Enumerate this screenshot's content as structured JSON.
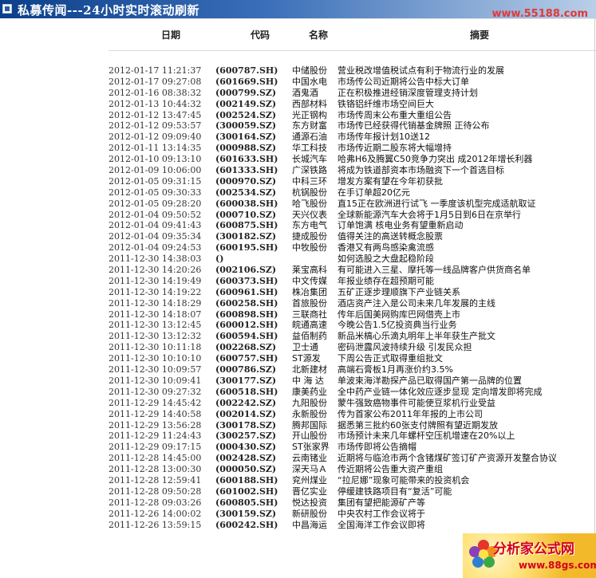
{
  "banner": {
    "title": "私募传闻---24小时实时滚动刷新",
    "site": "www.55188.com"
  },
  "header": {
    "date": "日期",
    "code": "代码",
    "name": "名称",
    "summary": "摘要"
  },
  "ad": {
    "title": "分析家公式网",
    "url": "www.88gs.com"
  },
  "rows": [
    {
      "date": "2012-01-17 11:21:37",
      "code": "(600787.SH)",
      "name": "中储股份",
      "summary": "营业税改增值税试点有利于物流行业的发展"
    },
    {
      "date": "2012-01-17 09:27:08",
      "code": "(601669.SH)",
      "name": "中国水电",
      "summary": "市场传公司近期将公告中标大订单"
    },
    {
      "date": "2012-01-16 08:38:32",
      "code": "(000799.SZ)",
      "name": "酒鬼酒",
      "summary": "正在积极推进经销深度管理支持计划"
    },
    {
      "date": "2012-01-13 10:44:32",
      "code": "(002149.SZ)",
      "name": "西部材料",
      "summary": "铁铬铝纤维市场空间巨大"
    },
    {
      "date": "2012-01-12 13:47:45",
      "code": "(002524.SZ)",
      "name": "光正钢构",
      "summary": "市场传周末公布重大重组公告"
    },
    {
      "date": "2012-01-12 09:53:57",
      "code": "(300059.SZ)",
      "name": "东方财富",
      "summary": "市场传已经获得代销基金牌照 正待公布"
    },
    {
      "date": "2012-01-12 09:09:40",
      "code": "(300164.SZ)",
      "name": "通源石油",
      "summary": "市场传年报计划10送12"
    },
    {
      "date": "2012-01-11 13:14:35",
      "code": "(000988.SZ)",
      "name": "华工科技",
      "summary": "市场传近期二股东将大幅增持"
    },
    {
      "date": "2012-01-10 09:13:10",
      "code": "(601633.SH)",
      "name": "长城汽车",
      "summary": "哈弗H6及腾翼C50竞争力突出 成2012年增长利器"
    },
    {
      "date": "2012-01-09 10:06:00",
      "code": "(601333.SH)",
      "name": "广深铁路",
      "summary": "将成为铁道部资本市场融资下一个首选目标"
    },
    {
      "date": "2012-01-05 09:31:15",
      "code": "(000970.SZ)",
      "name": "中科三环",
      "summary": "增发方案有望在今年初获批"
    },
    {
      "date": "2012-01-05 09:30:33",
      "code": "(002534.SZ)",
      "name": "杭锅股份",
      "summary": "在手订单超20亿元"
    },
    {
      "date": "2012-01-05 09:28:20",
      "code": "(600038.SH)",
      "name": "哈飞股份",
      "summary": "直15正在欧洲进行试飞 一季度该机型完成适航取证"
    },
    {
      "date": "2012-01-04 09:50:52",
      "code": "(000710.SZ)",
      "name": "天兴仪表",
      "summary": "全球新能源汽车大会将于1月5日到6日在京举行"
    },
    {
      "date": "2012-01-04 09:41:43",
      "code": "(600875.SH)",
      "name": "东方电气",
      "summary": "订单饱满 核电业务有望重新启动"
    },
    {
      "date": "2012-01-04 09:35:34",
      "code": "(300182.SZ)",
      "name": "捷成股份",
      "summary": "值得关注的高送转概念股票"
    },
    {
      "date": "2012-01-04 09:24:53",
      "code": "(600195.SH)",
      "name": "中牧股份",
      "summary": "香港又有两鸟感染禽流感"
    },
    {
      "date": "2011-12-30 14:38:03",
      "code": "()",
      "name": "",
      "summary": "如何选股之大盘起稳阶段"
    },
    {
      "date": "2011-12-30 14:20:26",
      "code": "(002106.SZ)",
      "name": "莱宝高科",
      "summary": "有可能进入三星、摩托等一线品牌客户供货商名单"
    },
    {
      "date": "2011-12-30 14:19:49",
      "code": "(600373.SH)",
      "name": "中文传媒",
      "summary": "年报业绩存在超预期可能"
    },
    {
      "date": "2011-12-30 14:19:22",
      "code": "(600961.SH)",
      "name": "株冶集团",
      "summary": "五矿正逐步理顺旗下产业链关系"
    },
    {
      "date": "2011-12-30 14:18:29",
      "code": "(600258.SH)",
      "name": "首旅股份",
      "summary": "酒店资产注入是公司未来几年发展的主线"
    },
    {
      "date": "2011-12-30 14:18:07",
      "code": "(600898.SH)",
      "name": "三联商社",
      "summary": "传年后国美网购库巴网借壳上市"
    },
    {
      "date": "2011-12-30 13:12:45",
      "code": "(600012.SH)",
      "name": "皖通高速",
      "summary": "今晚公告1.5亿投资典当行业务"
    },
    {
      "date": "2011-12-30 13:12:32",
      "code": "(600594.SH)",
      "name": "益佰制药",
      "summary": "新品米槁心乐滴丸明年上半年获生产批文"
    },
    {
      "date": "2011-12-30 10:11:18",
      "code": "(002268.SZ)",
      "name": "卫士通",
      "summary": "密码泄露风波持续升级 引发民众担"
    },
    {
      "date": "2011-12-30 10:10:10",
      "code": "(600757.SH)",
      "name": "ST源发",
      "summary": "下周公告正式取得重组批文"
    },
    {
      "date": "2011-12-30 10:09:57",
      "code": "(000786.SZ)",
      "name": "北新建材",
      "summary": "高端石膏板1月再涨价约3.5%"
    },
    {
      "date": "2011-12-30 10:09:41",
      "code": "(300177.SZ)",
      "name": "中 海 达",
      "summary": "单波束海洋勘探产品已取得国产第一品牌的位置"
    },
    {
      "date": "2011-12-30 09:27:32",
      "code": "(600518.SH)",
      "name": "康美药业",
      "summary": "全中药产业链一体化效应逐步显现 定向增发即将完成"
    },
    {
      "date": "2011-12-29 14:45:42",
      "code": "(002242.SZ)",
      "name": "九阳股份",
      "summary": "蒙牛强致癌物事件可能使豆浆机行业受益"
    },
    {
      "date": "2011-12-29 14:40:58",
      "code": "(002014.SZ)",
      "name": "永新股份",
      "summary": "传为首家公布2011年年报的上市公司"
    },
    {
      "date": "2011-12-29 13:56:28",
      "code": "(300178.SZ)",
      "name": "腾邦国际",
      "summary": "据悉第三批约60张支付牌照有望近期发放"
    },
    {
      "date": "2011-12-29 11:24:43",
      "code": "(300257.SZ)",
      "name": "开山股份",
      "summary": "市场预计未来几年螺杆空压机增速在20%以上"
    },
    {
      "date": "2011-12-29 09:17:15",
      "code": "(000430.SZ)",
      "name": "ST张家界",
      "summary": "市场传即将公告摘帽"
    },
    {
      "date": "2011-12-28 14:45:00",
      "code": "(002428.SZ)",
      "name": "云南锗业",
      "summary": "近期将与临沧市两个含锗煤矿签订矿产资源开发整合协议"
    },
    {
      "date": "2011-12-28 13:00:30",
      "code": "(000050.SZ)",
      "name": "深天马Ａ",
      "summary": "传近期将公告重大资产重组"
    },
    {
      "date": "2011-12-28 12:59:41",
      "code": "(600188.SH)",
      "name": "兖州煤业",
      "summary": "“拉尼娜”现象可能带来的投资机会"
    },
    {
      "date": "2011-12-28 09:50:28",
      "code": "(601002.SH)",
      "name": "晋亿实业",
      "summary": "停缓建铁路项目有“复活”可能"
    },
    {
      "date": "2011-12-28 09:03:26",
      "code": "(600805.SH)",
      "name": "悦达投资",
      "summary": "集团有望把能源矿产等"
    },
    {
      "date": "2011-12-26 14:00:02",
      "code": "(300159.SZ)",
      "name": "新研股份",
      "summary": "中央农村工作会议将于"
    },
    {
      "date": "2011-12-26 13:59:15",
      "code": "(600242.SH)",
      "name": "中昌海运",
      "summary": "全国海洋工作会议即将"
    }
  ]
}
